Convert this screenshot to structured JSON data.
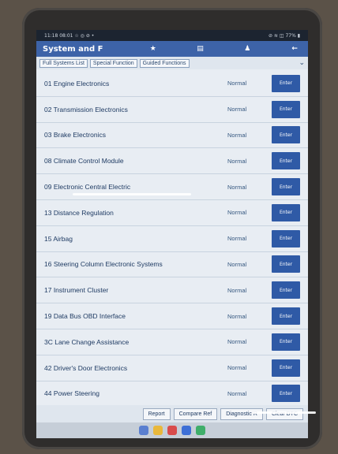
{
  "statusbar": {
    "time": "11:18 08:01 ☆ ◎ ⊘ •",
    "right": "⊘ ≋ ◫ 77% ▮"
  },
  "appbar": {
    "title": "System and F"
  },
  "tabs": [
    "Full Systems List",
    "Special Function",
    "Guided Functions"
  ],
  "rows": [
    {
      "label": "01 Engine Electronics",
      "status": "Normal",
      "button": "Enter"
    },
    {
      "label": "02 Transmission Electronics",
      "status": "Normal",
      "button": "Enter"
    },
    {
      "label": "03 Brake Electronics",
      "status": "Normal",
      "button": "Enter"
    },
    {
      "label": "08 Climate Control Module",
      "status": "Normal",
      "button": "Enter"
    },
    {
      "label": "09 Electronic Central Electric",
      "status": "Normal",
      "button": "Enter"
    },
    {
      "label": "13 Distance Regulation",
      "status": "Normal",
      "button": "Enter"
    },
    {
      "label": "15 Airbag",
      "status": "Normal",
      "button": "Enter"
    },
    {
      "label": "16 Steering Column Electronic Systems",
      "status": "Normal",
      "button": "Enter"
    },
    {
      "label": "17 Instrument Cluster",
      "status": "Normal",
      "button": "Enter"
    },
    {
      "label": "19 Data Bus OBD Interface",
      "status": "Normal",
      "button": "Enter"
    },
    {
      "label": "3C Lane Change Assistance",
      "status": "Normal",
      "button": "Enter"
    },
    {
      "label": "42 Driver's Door Electronics",
      "status": "Normal",
      "button": "Enter"
    },
    {
      "label": "44 Power Steering",
      "status": "Normal",
      "button": "Enter"
    }
  ],
  "bottom_buttons": [
    "Report",
    "Compare Ref",
    "Diagnostic R",
    "Clear DTC"
  ],
  "colors": {
    "appbar": "#3d63a8",
    "enter": "#2f5aa6",
    "screen": "#e8edf3"
  }
}
